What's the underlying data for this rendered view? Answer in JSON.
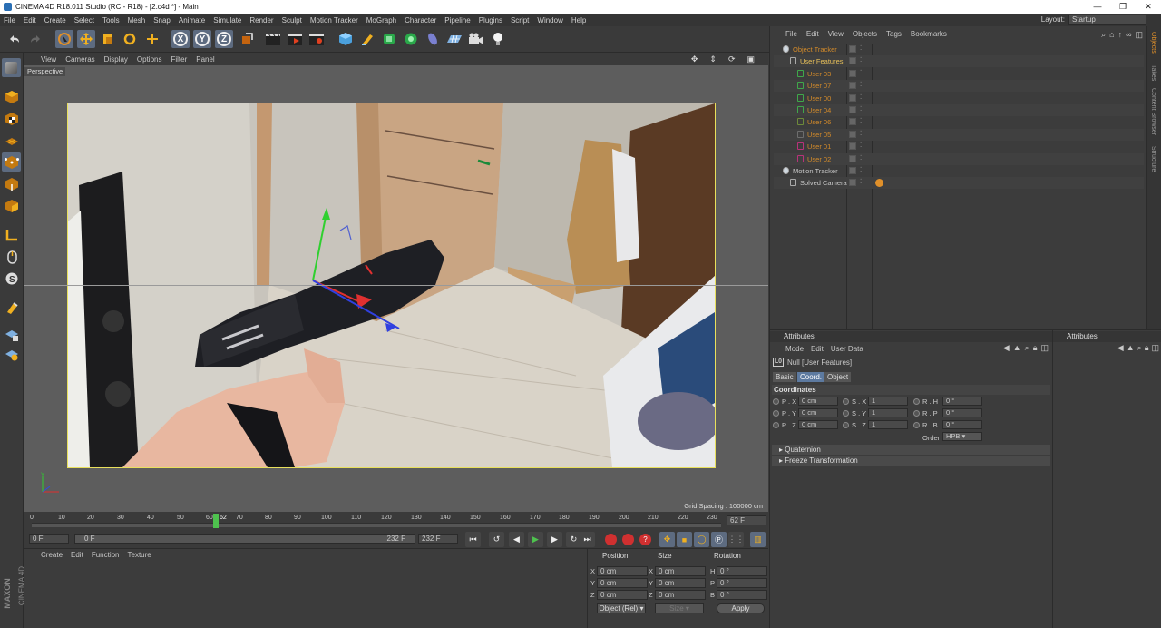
{
  "window": {
    "title": "CINEMA 4D R18.011 Studio (RC - R18) - [2.c4d *] - Main"
  },
  "menubar": {
    "items": [
      "File",
      "Edit",
      "Create",
      "Select",
      "Tools",
      "Mesh",
      "Snap",
      "Animate",
      "Simulate",
      "Render",
      "Sculpt",
      "Motion Tracker",
      "MoGraph",
      "Character",
      "Pipeline",
      "Plugins",
      "Script",
      "Window",
      "Help"
    ],
    "layout_label": "Layout:",
    "layout_value": "Startup"
  },
  "toolbar": {
    "axis_x": "X",
    "axis_y": "Y",
    "axis_z": "Z"
  },
  "viewport": {
    "menu": [
      "View",
      "Cameras",
      "Display",
      "Options",
      "Filter",
      "Panel"
    ],
    "label": "Perspective",
    "grid_spacing": "Grid Spacing : 100000 cm"
  },
  "timeline": {
    "ticks": [
      "0",
      "10",
      "20",
      "30",
      "40",
      "50",
      "60",
      "62",
      "70",
      "80",
      "90",
      "100",
      "110",
      "120",
      "130",
      "140",
      "150",
      "160",
      "170",
      "180",
      "190",
      "200",
      "210",
      "220",
      "230"
    ],
    "current_frame": "62 F",
    "start_frame": "0 F",
    "range_start": "0 F",
    "range_end": "232 F",
    "end_frame": "232 F"
  },
  "material": {
    "menu": [
      "Create",
      "Edit",
      "Function",
      "Texture"
    ],
    "logo_top": "MAXON",
    "logo_bottom": "CINEMA 4D"
  },
  "coords": {
    "headers": {
      "position": "Position",
      "size": "Size",
      "rotation": "Rotation"
    },
    "rows": [
      {
        "axis": "X",
        "pos": "0 cm",
        "size": "0 cm",
        "rot_axis": "H",
        "rot": "0 °"
      },
      {
        "axis": "Y",
        "pos": "0 cm",
        "size": "0 cm",
        "rot_axis": "P",
        "rot": "0 °"
      },
      {
        "axis": "Z",
        "pos": "0 cm",
        "size": "0 cm",
        "rot_axis": "B",
        "rot": "0 °"
      }
    ],
    "mode": "Object (Rel)",
    "size_mode": "Size",
    "apply": "Apply"
  },
  "objects": {
    "menu": [
      "File",
      "Edit",
      "View",
      "Objects",
      "Tags",
      "Bookmarks"
    ],
    "items": [
      {
        "name": "Object Tracker",
        "color": "#d28a2a"
      },
      {
        "name": "User Features",
        "color": "#e8c05a"
      },
      {
        "name": "User 03",
        "color": "#d28a2a",
        "icon": "#3fa84a"
      },
      {
        "name": "User 07",
        "color": "#d28a2a",
        "icon": "#3fa84a"
      },
      {
        "name": "User 00",
        "color": "#d28a2a",
        "icon": "#3fa84a"
      },
      {
        "name": "User 04",
        "color": "#d28a2a",
        "icon": "#3fa84a"
      },
      {
        "name": "User 06",
        "color": "#d28a2a",
        "icon": "#6d8a3a"
      },
      {
        "name": "User 05",
        "color": "#d28a2a",
        "icon": "#6d6d6d"
      },
      {
        "name": "User 01",
        "color": "#d28a2a",
        "icon": "#b8327a"
      },
      {
        "name": "User 02",
        "color": "#d28a2a",
        "icon": "#b8327a"
      },
      {
        "name": "Motion Tracker",
        "color": "#c8c8c8"
      },
      {
        "name": "Solved Camera",
        "color": "#c8c8c8"
      }
    ]
  },
  "side_tabs": [
    "Objects",
    "Takes",
    "Content Browser",
    "Structure"
  ],
  "attributes": {
    "title": "Attributes",
    "menu": [
      "Mode",
      "Edit",
      "User Data"
    ],
    "object_label": "Null [User Features]",
    "tabs": [
      "Basic",
      "Coord.",
      "Object"
    ],
    "section": "Coordinates",
    "params": [
      {
        "p": "P . X",
        "pv": "0 cm",
        "s": "S . X",
        "sv": "1",
        "r": "R . H",
        "rv": "0 °"
      },
      {
        "p": "P . Y",
        "pv": "0 cm",
        "s": "S . Y",
        "sv": "1",
        "r": "R . P",
        "rv": "0 °"
      },
      {
        "p": "P . Z",
        "pv": "0 cm",
        "s": "S . Z",
        "sv": "1",
        "r": "R . B",
        "rv": "0 °"
      }
    ],
    "order_label": "Order",
    "order_value": "HPB",
    "sections": [
      "Quaternion",
      "Freeze Transformation"
    ],
    "second_title": "Attributes"
  },
  "colors": {
    "accent": "#5d7aa0",
    "frame_border": "#e8e05c",
    "playhead": "#4ec24e"
  }
}
